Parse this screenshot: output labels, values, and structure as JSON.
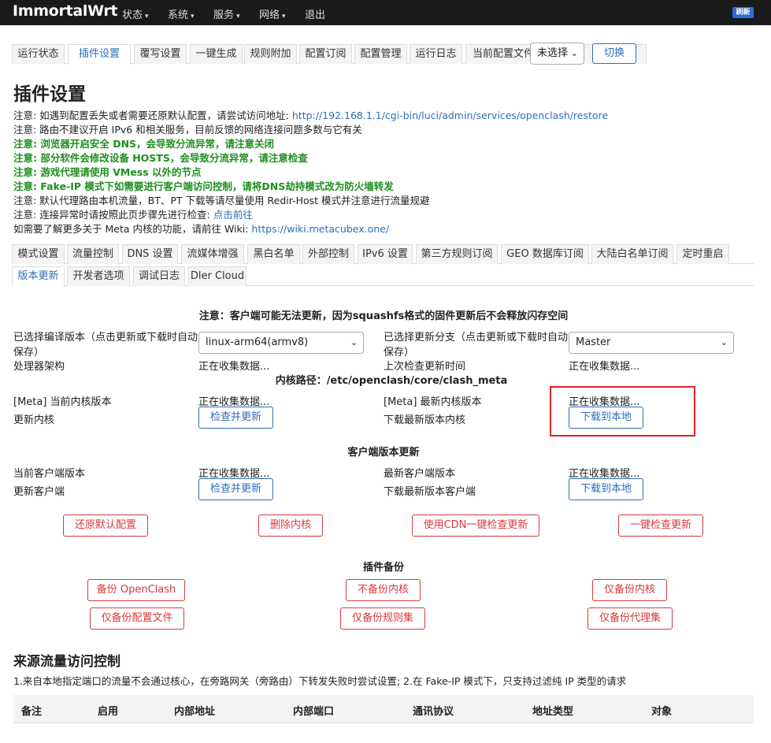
{
  "topbar": {
    "brand": "ImmortalWrt",
    "menus": [
      "状态",
      "系统",
      "服务",
      "网络",
      "退出"
    ],
    "refresh_badge": "刷新"
  },
  "tabs": {
    "items": [
      "运行状态",
      "插件设置",
      "覆写设置",
      "一键生成",
      "规则附加",
      "配置订阅",
      "配置管理",
      "运行日志"
    ],
    "config_label": "当前配置文件:",
    "config_select": "未选择",
    "switch_button": "切换"
  },
  "page_title": "插件设置",
  "notes": {
    "n1_prefix": "注意: 如遇到配置丢失或者需要还原默认配置，请尝试访问地址: ",
    "n1_link": "http://192.168.1.1/cgi-bin/luci/admin/services/openclash/restore",
    "n2": "注意: 路由不建议开启 IPv6 和相关服务，目前反馈的网络连接问题多数与它有关",
    "n3": "注意: 浏览器开启安全 DNS，会导致分流异常，请注意关闭",
    "n4": "注意: 部分软件会修改设备 HOSTS，会导致分流异常，请注意检查",
    "n5": "注意: 游戏代理请使用 VMess 以外的节点",
    "n6": "注意: Fake-IP 模式下如需要进行客户端访问控制，请将DNS劫持模式改为防火墙转发",
    "n7": "注意: 默认代理路由本机流量，BT、PT 下载等请尽量使用 Redir-Host 模式并注意进行流量规避",
    "n8_prefix": "注意: 连接异常时请按照此页步骤先进行检查: ",
    "n8_link": "点击前往",
    "n9_prefix": "如需要了解更多关于 Meta 内核的功能，请前往 Wiki: ",
    "n9_link": "https://wiki.metacubex.one/"
  },
  "subtabs": {
    "row1": [
      "模式设置",
      "流量控制",
      "DNS 设置",
      "流媒体增强",
      "黑白名单",
      "外部控制",
      "IPv6 设置",
      "第三方规则订阅",
      "GEO 数据库订阅",
      "大陆白名单订阅",
      "定时重启"
    ],
    "row2": [
      "版本更新",
      "开发者选项",
      "调试日志",
      "Dler Cloud"
    ]
  },
  "update": {
    "warning": "注意：客户端可能无法更新，因为squashfs格式的固件更新后不会释放闪存空间",
    "compile_label_1": "已选择编译版本（点击更新或下载时自动",
    "compile_label_2": "保存）",
    "compile_value": "linux-arm64(armv8)",
    "branch_label_1": "已选择更新分支（点击更新或下载时自动",
    "branch_label_2": "保存）",
    "branch_value": "Master",
    "arch_label": "处理器架构",
    "collecting": "正在收集数据...",
    "last_check_label": "上次检查更新时间",
    "core_path": "内核路径：/etc/openclash/core/clash_meta",
    "meta_current_label": "[Meta] 当前内核版本",
    "meta_latest_label": "[Meta] 最新内核版本",
    "update_core_label": "更新内核",
    "download_core_label": "下载最新版本内核",
    "check_update_btn": "检查并更新",
    "download_local_btn": "下载到本地",
    "client_section": "客户端版本更新",
    "client_current_label": "当前客户端版本",
    "client_latest_label": "最新客户端版本",
    "update_client_label": "更新客户端",
    "download_client_label": "下载最新版本客户端"
  },
  "actions": {
    "restore_default": "还原默认配置",
    "delete_core": "删除内核",
    "cdn_check": "使用CDN一键检查更新",
    "one_click_check": "一键检查更新"
  },
  "backup": {
    "title": "插件备份",
    "backup_openclash": "备份 OpenClash",
    "no_backup_core": "不备份内核",
    "only_core": "仅备份内核",
    "only_config": "仅备份配置文件",
    "only_rules": "仅备份规则集",
    "only_proxy": "仅备份代理集"
  },
  "traffic": {
    "title": "来源流量访问控制",
    "desc": "1.来自本地指定端口的流量不会通过核心，在旁路网关（旁路由）下转发失败时尝试设置; 2.在 Fake-IP 模式下，只支持过滤纯 IP 类型的请求",
    "columns": [
      "备注",
      "启用",
      "内部地址",
      "内部端口",
      "通讯协议",
      "地址类型",
      "对象"
    ]
  }
}
